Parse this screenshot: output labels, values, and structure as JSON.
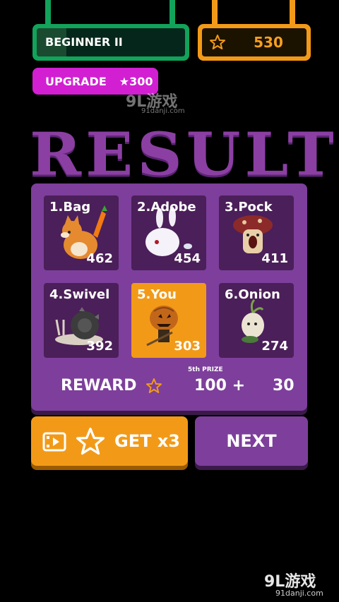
{
  "rank": {
    "label": "BEGINNER II",
    "progress": 0.2
  },
  "coins": {
    "value": "530"
  },
  "upgrade": {
    "label": "UPGRADE",
    "cost": "★300"
  },
  "watermark": {
    "logo": "9L游戏",
    "site": "91danji.com"
  },
  "title": "RESULT",
  "players": [
    {
      "name": "1.Bag",
      "score": "462",
      "icon": "fox-icon"
    },
    {
      "name": "2.Adobe",
      "score": "454",
      "icon": "bunny-icon"
    },
    {
      "name": "3.Pock",
      "score": "411",
      "icon": "mushroom-icon"
    },
    {
      "name": "4.Swivel",
      "score": "392",
      "icon": "snail-icon"
    },
    {
      "name": "5.You",
      "score": "303",
      "icon": "pumpkin-icon"
    },
    {
      "name": "6.Onion",
      "score": "274",
      "icon": "onion-icon"
    }
  ],
  "reward": {
    "label": "REWARD",
    "prize_tag": "5th PRIZE",
    "prize_value": "100 +",
    "bonus_value": "30"
  },
  "buttons": {
    "get_x3": "GET x3",
    "next": "NEXT"
  },
  "colors": {
    "orange": "#f29a18",
    "purple": "#7d3f9b",
    "green": "#12a35a",
    "magenta": "#d21fd2"
  }
}
